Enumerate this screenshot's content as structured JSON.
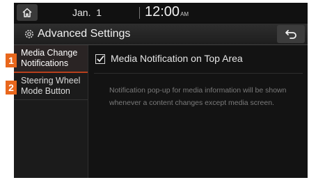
{
  "status_bar": {
    "date": "Jan.  1",
    "time": "12:00",
    "ampm": "AM"
  },
  "header": {
    "title": "Advanced Settings"
  },
  "sidebar": {
    "items": [
      {
        "badge": "1",
        "line1": "Media Change",
        "line2": "Notifications"
      },
      {
        "badge": "2",
        "line1": "Steering Wheel",
        "line2": "Mode Button"
      }
    ]
  },
  "main": {
    "option_label": "Media Notification on Top Area",
    "option_checked": true,
    "description": "Notification pop-up for media information will be shown whenever a content changes except media screen."
  },
  "colors": {
    "accent": "#e8671c",
    "background": "#0f0f0f"
  }
}
